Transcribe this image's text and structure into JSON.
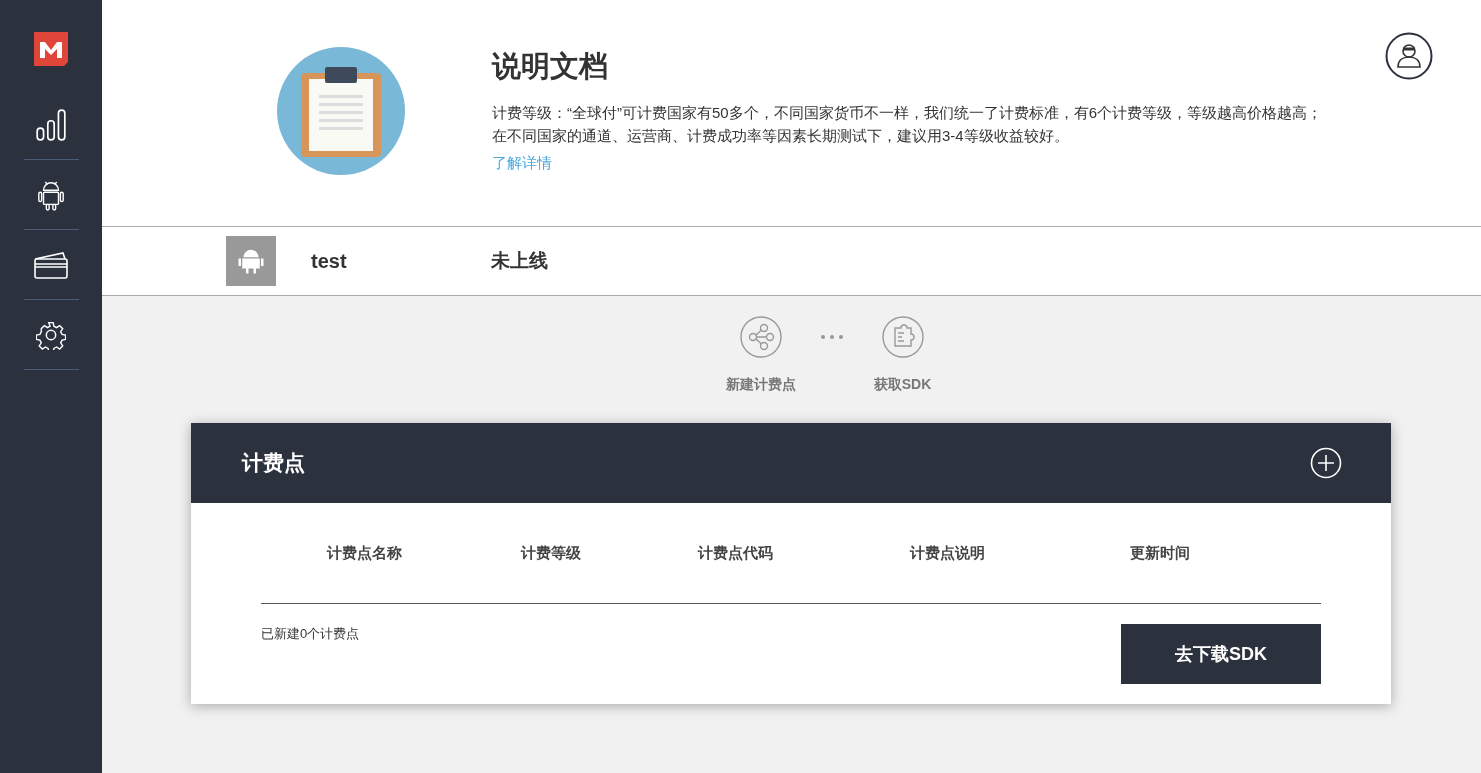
{
  "sidebar": {
    "items": [
      {
        "kind": "chart"
      },
      {
        "kind": "android"
      },
      {
        "kind": "card"
      },
      {
        "kind": "settings"
      }
    ]
  },
  "doc": {
    "title": "说明文档",
    "lines": [
      "计费等级：“全球付”可计费国家有50多个，不同国家货币不一样，我们统一了计费标准，有6个计费等级，等级越高价格越高；",
      "在不同国家的通道、运营商、计费成功率等因素长期测试下，建议用3-4等级收益较好。"
    ],
    "link": "了解详情"
  },
  "app": {
    "name": "test",
    "status": "未上线"
  },
  "actions": [
    {
      "kind": "share",
      "label": "新建计费点"
    },
    {
      "kind": "sdk",
      "label": "获取SDK"
    }
  ],
  "table": {
    "title": "计费点",
    "columns": [
      "计费点名称",
      "计费等级",
      "计费点代码",
      "计费点说明",
      "更新时间"
    ],
    "count_text": "已新建0个计费点",
    "button": "去下载SDK"
  }
}
